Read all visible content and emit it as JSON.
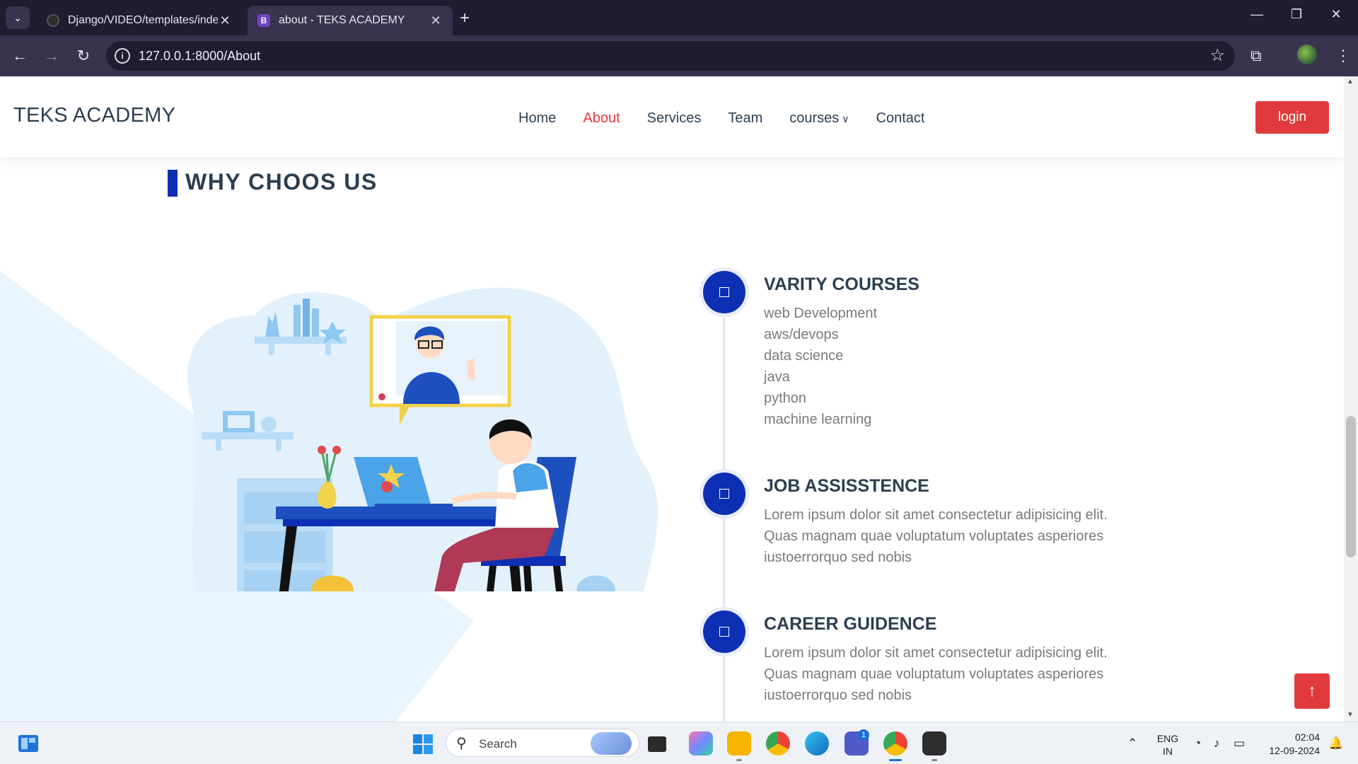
{
  "browser": {
    "tabs": [
      {
        "title": "Django/VIDEO/templates/index",
        "favicon": "github-icon",
        "active": false
      },
      {
        "title": "about - TEKS ACADEMY",
        "favicon": "B",
        "active": true
      }
    ],
    "url": "127.0.0.1:8000/About"
  },
  "site": {
    "brand": "TEKS ACADEMY",
    "nav": [
      {
        "label": "Home",
        "active": false
      },
      {
        "label": "About",
        "active": true
      },
      {
        "label": "Services",
        "active": false
      },
      {
        "label": "Team",
        "active": false
      },
      {
        "label": "courses",
        "active": false,
        "dropdown": true
      },
      {
        "label": "Contact",
        "active": false
      }
    ],
    "login_label": "login",
    "accent_color": "#e03a3c",
    "primary_color": "#0d2fb4"
  },
  "section": {
    "title": "WHY CHOOS US",
    "items": [
      {
        "title": "VARITY COURSES",
        "lines": [
          "web Development",
          "aws/devops",
          "data science",
          "java",
          "python",
          "machine learning"
        ]
      },
      {
        "title": "JOB ASSISSTENCE",
        "lines": [
          "Lorem ipsum dolor sit amet consectetur adipisicing elit.",
          "Quas magnam quae voluptatum voluptates asperiores",
          "iustoerrorquo sed nobis"
        ]
      },
      {
        "title": "CAREER GUIDENCE",
        "lines": [
          "Lorem ipsum dolor sit amet consectetur adipisicing elit.",
          "Quas magnam quae voluptatum voluptates asperiores",
          "iustoerrorquo sed nobis"
        ]
      }
    ]
  },
  "taskbar": {
    "search_label": "Search",
    "language": [
      "ENG",
      "IN"
    ],
    "time": "02:04",
    "date": "12-09-2024",
    "teams_badge": "1"
  }
}
